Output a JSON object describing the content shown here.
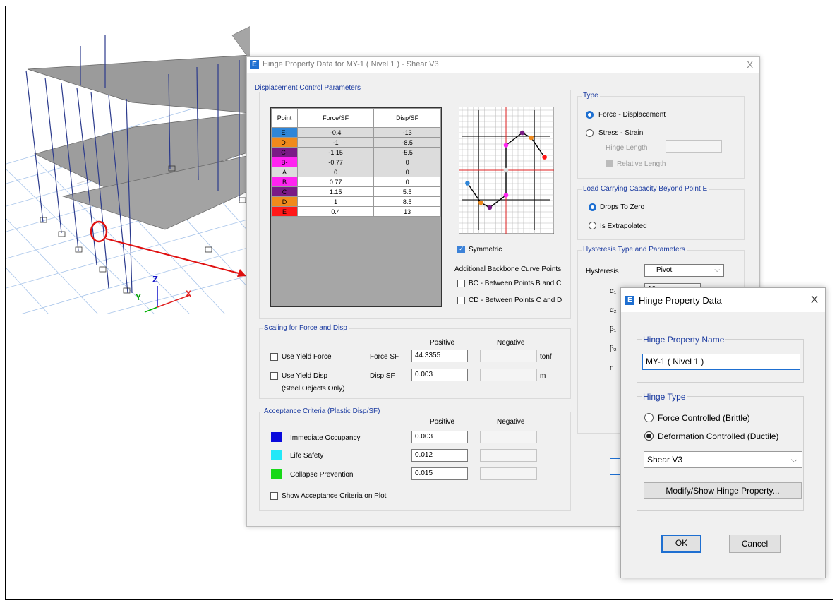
{
  "model_view": {
    "axis_labels": {
      "z": "Z",
      "y": "Y",
      "x": "X"
    }
  },
  "main_dialog": {
    "title": "Hinge Property Data for MY-1 ( Nivel 1 ) - Shear V3",
    "close": "X",
    "displacement_group": "Displacement Control Parameters",
    "table": {
      "headers": [
        "Point",
        "Force/SF",
        "Disp/SF"
      ],
      "rows": [
        {
          "point": "E-",
          "force": "-0.4",
          "disp": "-13",
          "color": "#2f86d8"
        },
        {
          "point": "D-",
          "force": "-1",
          "disp": "-8.5",
          "color": "#f08a1c"
        },
        {
          "point": "C-",
          "force": "-1.15",
          "disp": "-5.5",
          "color": "#7a1a86"
        },
        {
          "point": "B-",
          "force": "-0.77",
          "disp": "0",
          "color": "#ff24f0"
        },
        {
          "point": "A",
          "force": "0",
          "disp": "0",
          "color": "#dcdcdc"
        },
        {
          "point": "B",
          "force": "0.77",
          "disp": "0",
          "color": "#ff24f0"
        },
        {
          "point": "C",
          "force": "1.15",
          "disp": "5.5",
          "color": "#7a1a86"
        },
        {
          "point": "D",
          "force": "1",
          "disp": "8.5",
          "color": "#f08a1c"
        },
        {
          "point": "E",
          "force": "0.4",
          "disp": "13",
          "color": "#ff1818"
        }
      ]
    },
    "symmetric_label": "Symmetric",
    "symmetric_checked": true,
    "additional_points_label": "Additional Backbone Curve Points",
    "bc_label": "BC - Between Points B and C",
    "cd_label": "CD - Between Points C and D",
    "type_group": "Type",
    "force_disp_label": "Force - Displacement",
    "stress_strain_label": "Stress - Strain",
    "hinge_length_label": "Hinge Length",
    "relative_length_label": "Relative Length",
    "load_group": "Load Carrying Capacity Beyond Point E",
    "drops_label": "Drops To Zero",
    "extrapolated_label": "Is Extrapolated",
    "hysteresis_group": "Hysteresis Type and Parameters",
    "hysteresis_label": "Hysteresis",
    "hysteresis_value": "Pivot",
    "greek": [
      "α₁",
      "α₂",
      "β₁",
      "β₂",
      "η"
    ],
    "alpha1_value": "10",
    "scaling_group": "Scaling for Force and Disp",
    "positive": "Positive",
    "negative": "Negative",
    "use_yield_force": "Use Yield Force",
    "use_yield_disp": "Use Yield Disp",
    "steel_only": "(Steel Objects Only)",
    "force_sf_label": "Force SF",
    "force_sf_value": "44.3355",
    "force_unit": "tonf",
    "disp_sf_label": "Disp SF",
    "disp_sf_value": "0.003",
    "disp_unit": "m",
    "acceptance_group": "Acceptance Criteria (Plastic Disp/SF)",
    "io_label": "Immediate Occupancy",
    "io_value": "0.003",
    "io_color": "#0a0adc",
    "ls_label": "Life Safety",
    "ls_value": "0.012",
    "ls_color": "#22e8f8",
    "cp_label": "Collapse Prevention",
    "cp_value": "0.015",
    "cp_color": "#18d818",
    "show_acceptance": "Show Acceptance Criteria on Plot"
  },
  "hinge_dialog": {
    "title": "Hinge Property Data",
    "close": "X",
    "name_group": "Hinge Property Name",
    "name_value": "MY-1 ( Nivel 1 )",
    "type_group": "Hinge Type",
    "force_controlled": "Force Controlled  (Brittle)",
    "deformation_controlled": "Deformation Controlled  (Ductile)",
    "selected_type": "Shear V3",
    "modify_button": "Modify/Show Hinge Property...",
    "ok": "OK",
    "cancel": "Cancel"
  }
}
